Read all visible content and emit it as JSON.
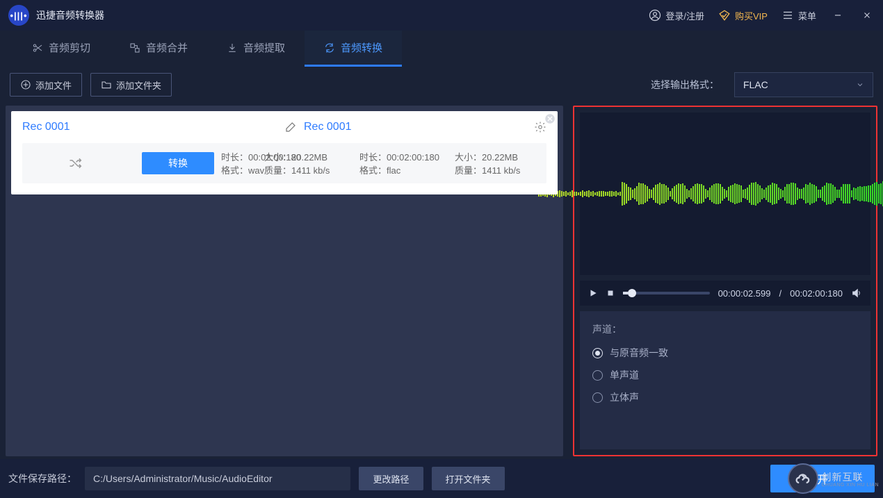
{
  "app": {
    "title": "迅捷音频转换器"
  },
  "titlebar": {
    "login": "登录/注册",
    "vip": "购买VIP",
    "menu": "菜单"
  },
  "tabs": [
    {
      "label": "音频剪切"
    },
    {
      "label": "音频合并"
    },
    {
      "label": "音频提取"
    },
    {
      "label": "音频转换",
      "active": true
    }
  ],
  "toolbar": {
    "add_file": "添加文件",
    "add_folder": "添加文件夹",
    "format_label": "选择输出格式：",
    "format_value": "FLAC"
  },
  "card": {
    "src_name": "Rec 0001",
    "dst_name": "Rec 0001",
    "src": {
      "duration_label": "时长：",
      "duration": "00:02:00:180",
      "size_label": "大小：",
      "size": "20.22MB",
      "format_label": "格式：",
      "format": "wav",
      "quality_label": "质量：",
      "quality": "1411 kb/s"
    },
    "dst": {
      "duration_label": "时长：",
      "duration": "00:02:00:180",
      "size_label": "大小：",
      "size": "20.22MB",
      "format_label": "格式：",
      "format": "flac",
      "quality_label": "质量：",
      "quality": "1411 kb/s"
    },
    "convert_btn": "转换"
  },
  "player": {
    "current": "00:00:02.599",
    "sep": "/",
    "total": "00:02:00:180"
  },
  "options": {
    "title": "声道：",
    "items": [
      {
        "label": "与原音频一致",
        "selected": true
      },
      {
        "label": "单声道",
        "selected": false
      },
      {
        "label": "立体声",
        "selected": false
      }
    ]
  },
  "bottom": {
    "path_label": "文件保存路径：",
    "path_value": "C:/Users/Administrator/Music/AudioEditor",
    "change_path": "更改路径",
    "open_folder": "打开文件夹",
    "start": "开"
  },
  "watermark": {
    "text": "创新互联",
    "sub": "CHUANG XIN HU LIAN"
  }
}
